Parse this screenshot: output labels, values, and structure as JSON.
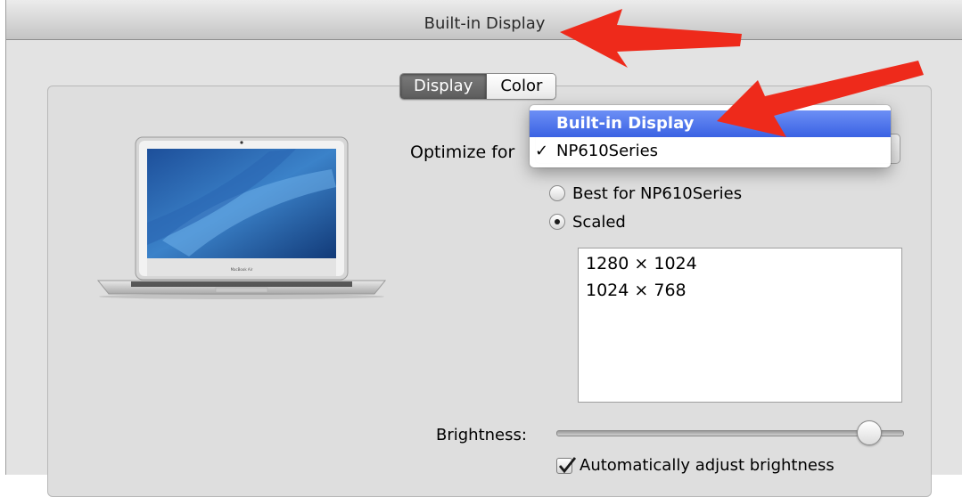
{
  "window": {
    "title": "Built-in Display"
  },
  "tabs": [
    {
      "label": "Display",
      "selected": true
    },
    {
      "label": "Color",
      "selected": false
    }
  ],
  "optimize": {
    "label": "Optimize for",
    "menu_items": [
      {
        "label": "Built-in Display",
        "highlighted": true,
        "checked": false
      },
      {
        "label": "NP610Series",
        "highlighted": false,
        "checked": true
      }
    ],
    "checkmark": "✓"
  },
  "resolution_options": [
    {
      "label": "Best for NP610Series",
      "selected": false
    },
    {
      "label": "Scaled",
      "selected": true
    }
  ],
  "resolutions": [
    "1280 × 1024",
    "1024 × 768"
  ],
  "brightness": {
    "label": "Brightness:",
    "value": 0.9
  },
  "auto_brightness": {
    "label": "Automatically adjust brightness",
    "checked": true
  },
  "annotations": {
    "arrow_color": "#ee2a1b",
    "highlight_color": "#3a62e3"
  }
}
